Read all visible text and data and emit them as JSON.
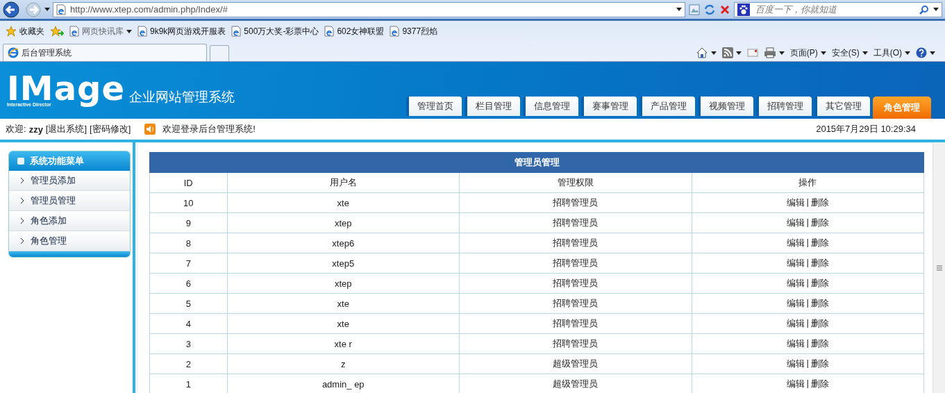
{
  "browser": {
    "address": "http://www.xtep.com/admin.php/Index/#",
    "search_placeholder": "百度一下，你就知道",
    "favorites_label": "收藏夹",
    "bookmarks": [
      {
        "label": "网页快讯库",
        "has_menu": true
      },
      {
        "label": "9k9k网页游戏开服表",
        "has_menu": false
      },
      {
        "label": "500万大奖-彩票中心",
        "has_menu": false
      },
      {
        "label": "602女神联盟",
        "has_menu": false
      },
      {
        "label": "9377烈焰",
        "has_menu": false
      }
    ],
    "tab_title": "后台管理系统",
    "commands": [
      "页面(P)",
      "安全(S)",
      "工具(O)"
    ]
  },
  "header": {
    "logo_wordmark": "IMage",
    "logo_tagline": "Interactive Director",
    "system_name": "企业网站管理系统",
    "nav": [
      {
        "label": "管理首页",
        "selected": false
      },
      {
        "label": "栏目管理",
        "selected": false
      },
      {
        "label": "信息管理",
        "selected": false
      },
      {
        "label": "赛事管理",
        "selected": false
      },
      {
        "label": "产品管理",
        "selected": false
      },
      {
        "label": "视频管理",
        "selected": false
      },
      {
        "label": "招聘管理",
        "selected": false
      },
      {
        "label": "其它管理",
        "selected": false
      },
      {
        "label": "角色管理",
        "selected": true
      }
    ]
  },
  "welcome": {
    "label": "欢迎:",
    "user": "zzy",
    "links": [
      "[退出系统]",
      "[密码修改]"
    ],
    "message": "欢迎登录后台管理系统!",
    "datetime": "2015年7月29日 10:29:34"
  },
  "sidebar": {
    "title": "系统功能菜单",
    "items": [
      "管理员添加",
      "管理员管理",
      "角色添加",
      "角色管理"
    ]
  },
  "table": {
    "title": "管理员管理",
    "columns": [
      "ID",
      "用户名",
      "管理权限",
      "操作"
    ],
    "rows": [
      {
        "id": "10",
        "username": "xte",
        "role": "招聘管理员",
        "actions": [
          "编辑",
          "|",
          "删除"
        ]
      },
      {
        "id": "9",
        "username": "xtep",
        "role": "招聘管理员",
        "actions": [
          "编辑",
          "|",
          "删除"
        ]
      },
      {
        "id": "8",
        "username": "xtep6",
        "role": "招聘管理员",
        "actions": [
          "编辑",
          "|",
          "删除"
        ]
      },
      {
        "id": "7",
        "username": "xtep5",
        "role": "招聘管理员",
        "actions": [
          "编辑",
          "|",
          "删除"
        ]
      },
      {
        "id": "6",
        "username": "xtep",
        "role": "招聘管理员",
        "actions": [
          "编辑",
          "|",
          "删除"
        ]
      },
      {
        "id": "5",
        "username": "xte",
        "role": "招聘管理员",
        "actions": [
          "编辑",
          "|",
          "删除"
        ]
      },
      {
        "id": "4",
        "username": "xte",
        "role": "招聘管理员",
        "actions": [
          "编辑",
          "|",
          "删除"
        ]
      },
      {
        "id": "3",
        "username": "xte r",
        "role": "招聘管理员",
        "actions": [
          "编辑",
          "|",
          "删除"
        ]
      },
      {
        "id": "2",
        "username": "z",
        "role": "超级管理员",
        "actions": [
          "编辑",
          "|",
          "删除"
        ]
      },
      {
        "id": "1",
        "username": "admin_ ep",
        "role": "超级管理员",
        "actions": [
          "编辑",
          "|",
          "删除"
        ]
      }
    ]
  }
}
